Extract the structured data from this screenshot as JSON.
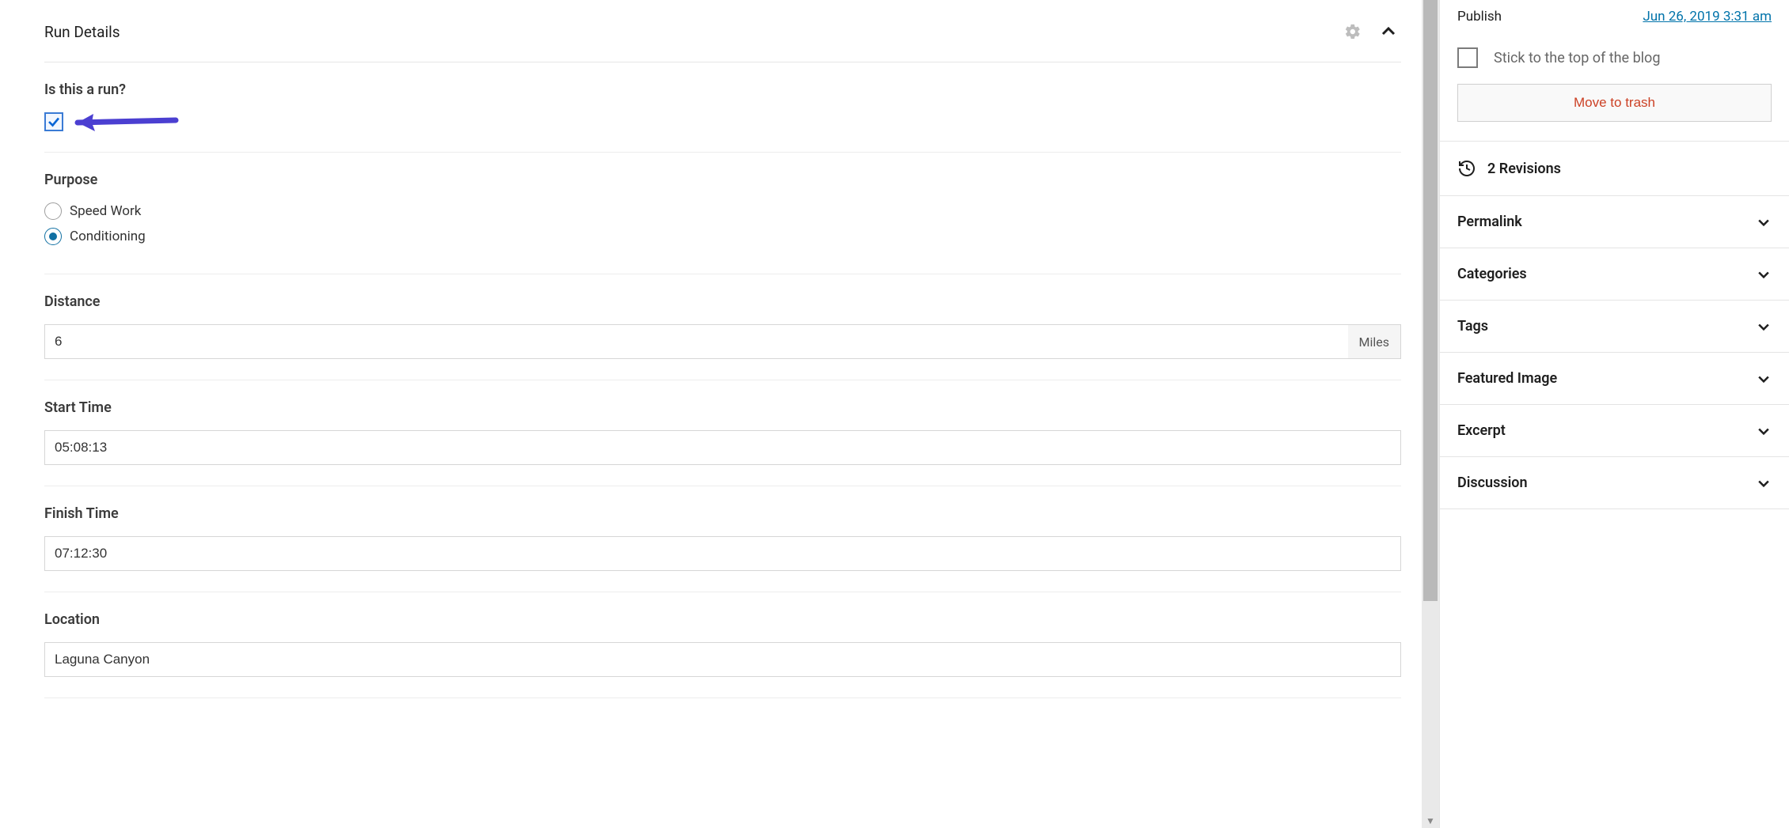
{
  "main": {
    "panel_title": "Run Details",
    "fields": {
      "is_run": {
        "label": "Is this a run?",
        "checked": true
      },
      "purpose": {
        "label": "Purpose",
        "options": [
          "Speed Work",
          "Conditioning"
        ],
        "selected": "Conditioning"
      },
      "distance": {
        "label": "Distance",
        "value": "6",
        "unit": "Miles"
      },
      "start_time": {
        "label": "Start Time",
        "value": "05:08:13"
      },
      "finish_time": {
        "label": "Finish Time",
        "value": "07:12:30"
      },
      "location": {
        "label": "Location",
        "value": "Laguna Canyon"
      }
    }
  },
  "sidebar": {
    "publish_label": "Publish",
    "publish_date": "Jun 26, 2019 3:31 am",
    "sticky_label": "Stick to the top of the blog",
    "trash_label": "Move to trash",
    "revisions_count": "2 Revisions",
    "panels": [
      "Permalink",
      "Categories",
      "Tags",
      "Featured Image",
      "Excerpt",
      "Discussion"
    ]
  }
}
